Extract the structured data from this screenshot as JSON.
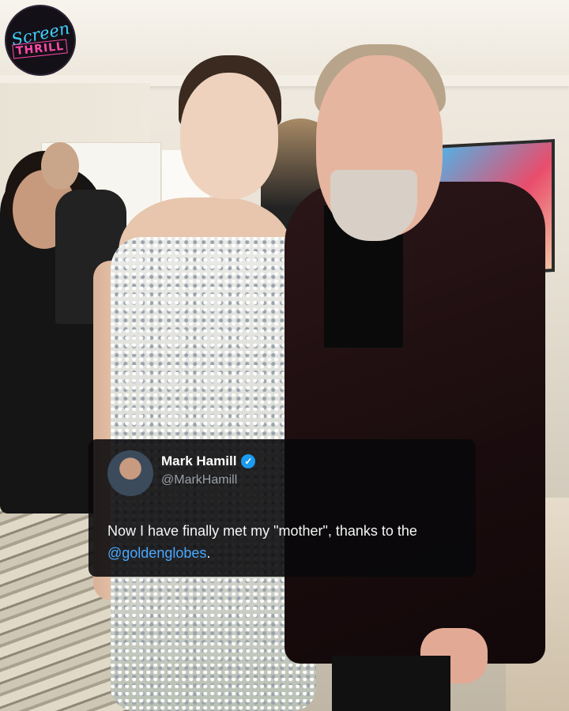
{
  "logo": {
    "line1": "Screen",
    "line2": "THRILL"
  },
  "tweet": {
    "name": "Mark Hamill",
    "verified_icon": "verified-badge-icon",
    "handle": "@MarkHamill",
    "text_before": "Now I have finally met my \"mother\", thanks to the ",
    "mention": "@goldenglobes",
    "text_after": ".",
    "accent_color": "#1d9bf0"
  }
}
